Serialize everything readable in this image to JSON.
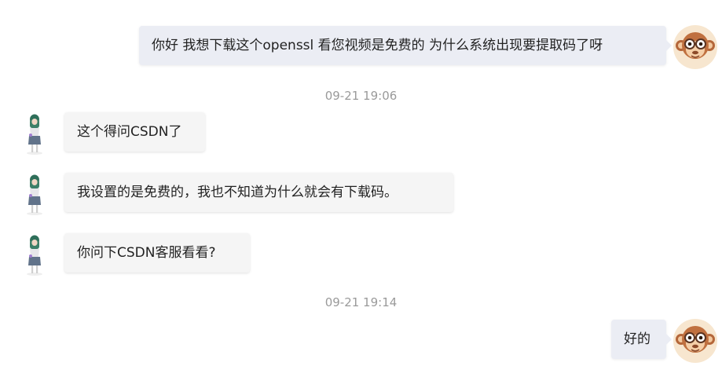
{
  "messages": [
    {
      "direction": "out",
      "text": "你好 我想下载这个openssl 看您视频是免费的 为什么系统出现要提取码了呀"
    },
    {
      "direction": "in",
      "text": "这个得问CSDN了"
    },
    {
      "direction": "in",
      "text": "我设置的是免费的，我也不知道为什么就会有下载码。"
    },
    {
      "direction": "in",
      "text": "你问下CSDN客服看看?"
    },
    {
      "direction": "out",
      "text": "好的"
    }
  ],
  "timestamps": [
    "09-21 19:06",
    "09-21 19:14"
  ],
  "avatars": {
    "self": "monkey-avatar-icon",
    "other": "girl-avatar-icon"
  },
  "colors": {
    "outgoing_bubble": "#ebedf4",
    "incoming_bubble": "#f5f5f5",
    "timestamp": "#9a9a9a"
  }
}
